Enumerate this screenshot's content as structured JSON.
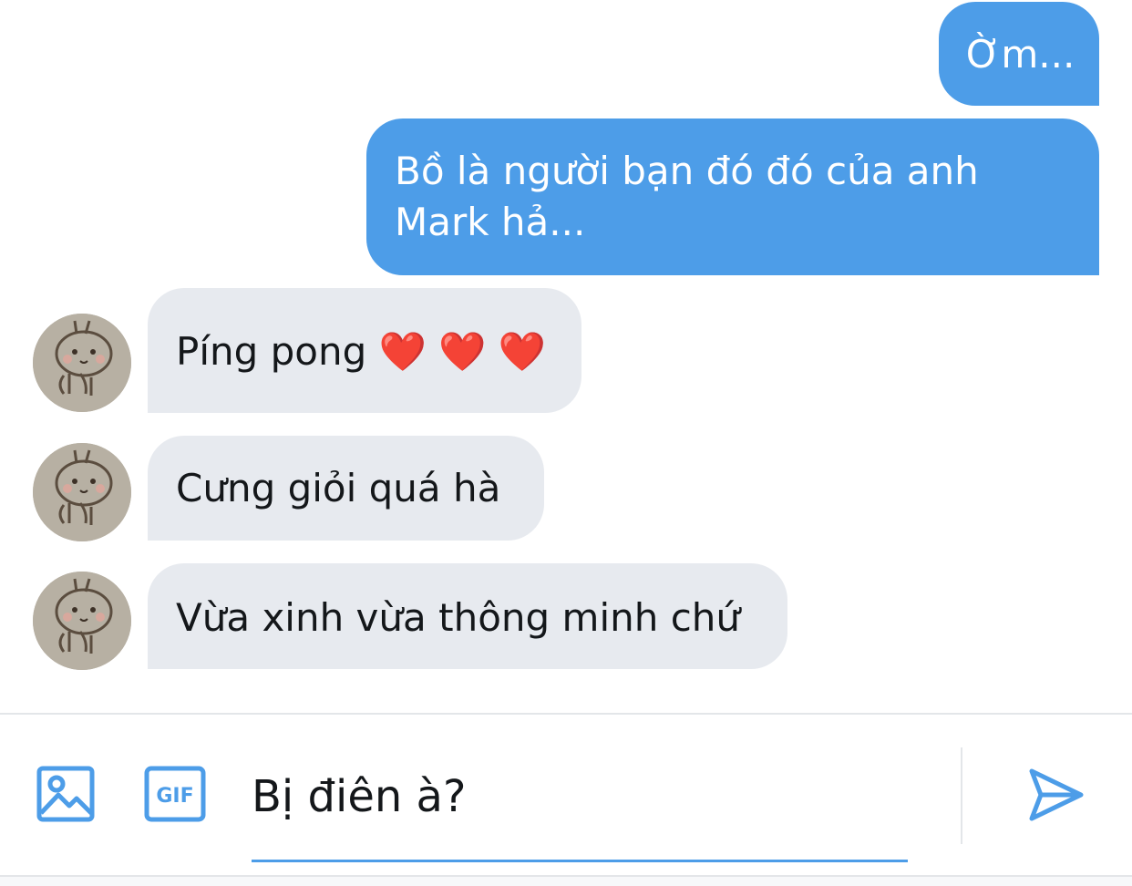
{
  "conversation": {
    "messages": [
      {
        "direction": "outgoing",
        "text": "Ờm..."
      },
      {
        "direction": "outgoing",
        "text": "Bồ là người bạn đó đó của anh\nMark hả..."
      },
      {
        "direction": "incoming",
        "text": "Píng pong ❤️ ❤️ ❤️"
      },
      {
        "direction": "incoming",
        "text": "Cưng giỏi quá hà"
      },
      {
        "direction": "incoming",
        "text": "Vừa xinh vừa thông minh chứ"
      }
    ]
  },
  "composer": {
    "draft_text": "Bị điên à?",
    "gif_label": "GIF",
    "icons": [
      "image-icon",
      "gif-icon",
      "send-icon"
    ]
  },
  "colors": {
    "outgoing_bubble": "#4d9de8",
    "incoming_bubble": "#e7eaef",
    "accent": "#4d9de8",
    "text": "#14171a"
  }
}
